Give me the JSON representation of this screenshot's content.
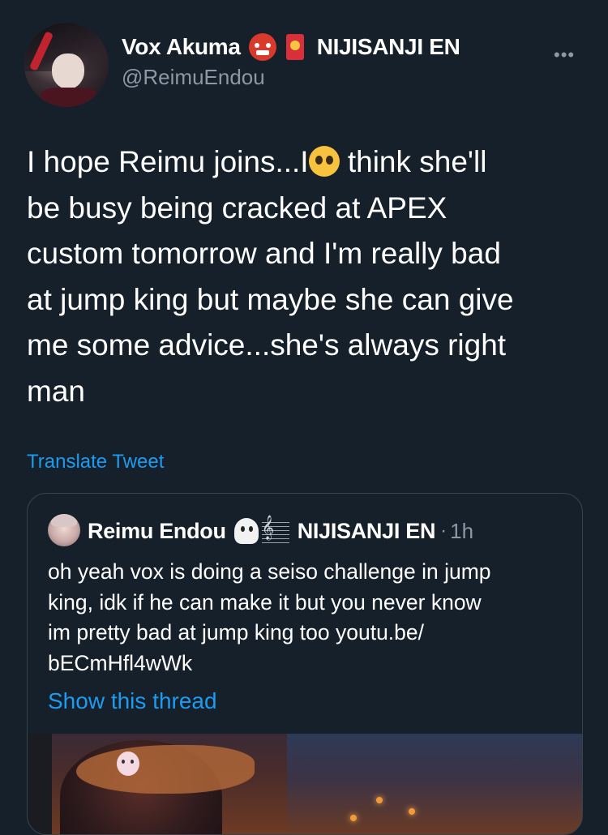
{
  "tweet": {
    "author": {
      "display_name": "Vox Akuma",
      "handle": "@ReimuEndou",
      "org_label": "NIJISANJI EN",
      "emojis": [
        "japanese-ogre-emoji",
        "red-envelope-emoji"
      ]
    },
    "text_part1": "I hope Reimu joins...I",
    "inline_emoji": "pleading-face-emoji",
    "text_part2": " think she'll\nbe busy being cracked at APEX\ncustom tomorrow and I'm really bad\nat jump king but maybe she can give\nme some advice...she's always right\nman",
    "translate_label": "Translate Tweet",
    "more_label": "•••"
  },
  "quote": {
    "author": {
      "display_name": "Reimu Endou",
      "org_label": "NIJISANJI EN",
      "emojis": [
        "ghost-emoji",
        "musical-score-emoji"
      ]
    },
    "separator": "·",
    "time": "1h",
    "text": "oh yeah vox is doing a seiso challenge in jump\nking, idk if he can make it but you never know\nim pretty bad at jump king too youtu.be/\nbECmHfl4wWk",
    "show_thread_label": "Show this thread"
  },
  "colors": {
    "background": "#15202b",
    "text": "#ffffff",
    "secondary": "#8b98a5",
    "link": "#1d9bf0",
    "border": "#38444d"
  }
}
